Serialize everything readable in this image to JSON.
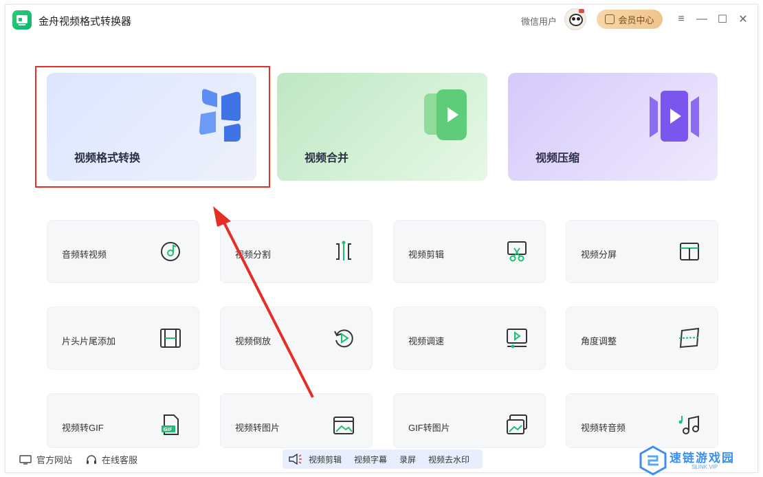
{
  "app": {
    "title": "金舟视频格式转换器",
    "username": "微信用户",
    "vip_label": "会员中心"
  },
  "window_controls": [
    "≡",
    "—",
    "☐",
    "✕"
  ],
  "feature_cards": [
    {
      "label": "视频格式转换",
      "highlighted": true
    },
    {
      "label": "视频合并"
    },
    {
      "label": "视频压缩"
    }
  ],
  "tools": [
    {
      "label": "音频转视频",
      "icon": "music-disc-icon"
    },
    {
      "label": "视频分割",
      "icon": "split-icon"
    },
    {
      "label": "视频剪辑",
      "icon": "scissors-icon"
    },
    {
      "label": "视频分屏",
      "icon": "split-screen-icon"
    },
    {
      "label": "片头片尾添加",
      "icon": "film-strip-icon"
    },
    {
      "label": "视频倒放",
      "icon": "rewind-play-icon"
    },
    {
      "label": "视频调速",
      "icon": "speed-monitor-icon"
    },
    {
      "label": "角度调整",
      "icon": "rotate-frame-icon"
    },
    {
      "label": "视频转GIF",
      "icon": "gif-file-icon"
    },
    {
      "label": "视频转图片",
      "icon": "picture-icon"
    },
    {
      "label": "GIF转图片",
      "icon": "gif-picture-icon"
    },
    {
      "label": "视频转音频",
      "icon": "music-notes-icon"
    }
  ],
  "bottom": {
    "website": "官方网站",
    "support": "在线客服"
  },
  "quickbar": [
    "视频剪辑",
    "视频字幕",
    "录屏",
    "视频去水印"
  ],
  "watermark": {
    "text": "速链游戏园",
    "sub": "SLINK.VIP"
  },
  "colors": {
    "accent_green": "#1fbf73",
    "highlight_red": "#e52e25",
    "vip_gold": "#efc58d"
  }
}
